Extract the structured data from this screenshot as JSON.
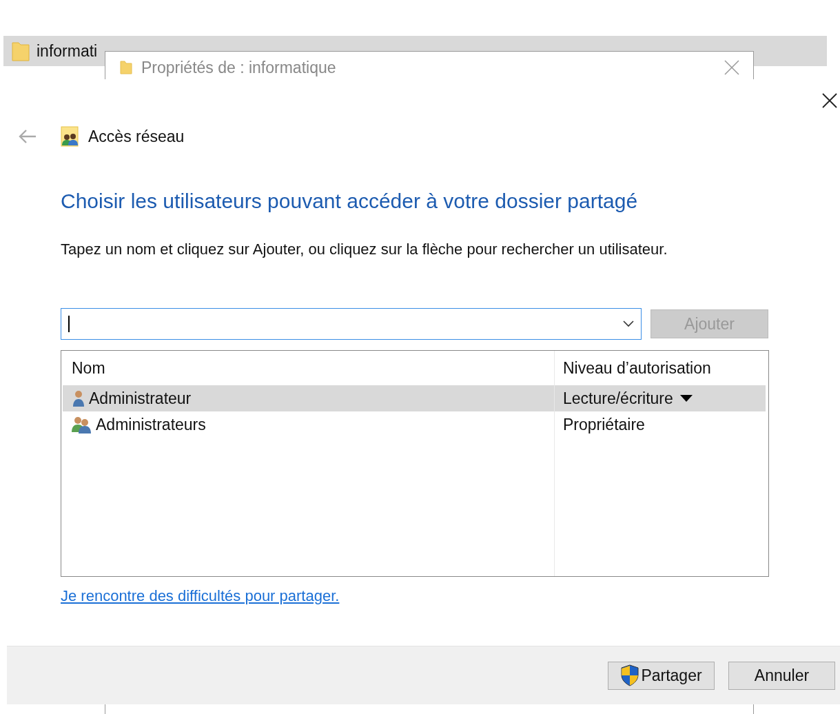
{
  "background_window": {
    "row": {
      "name": "informati",
      "selected": true
    }
  },
  "properties_window": {
    "title": "Propriétés de : informatique"
  },
  "wizard": {
    "title": "Accès réseau",
    "heading": "Choisir les utilisateurs pouvant accéder à votre dossier partagé",
    "instruction": "Tapez un nom et cliquez sur Ajouter, ou cliquez sur la flèche pour rechercher un utilisateur.",
    "add_button": {
      "label": "Ajouter",
      "disabled": true
    },
    "table": {
      "columns": [
        "Nom",
        "Niveau d’autorisation"
      ],
      "rows": [
        {
          "name": "Administrateur",
          "kind": "user",
          "permission": "Lecture/écriture",
          "selected": true
        },
        {
          "name": "Administrateurs",
          "kind": "group",
          "permission": "Propriétaire",
          "selected": false
        }
      ]
    },
    "help_link": "Je rencontre des difficultés pour partager.",
    "buttons": [
      {
        "label": "Partager",
        "kind": "shield"
      },
      {
        "label": "Annuler",
        "kind": "plain"
      }
    ]
  }
}
